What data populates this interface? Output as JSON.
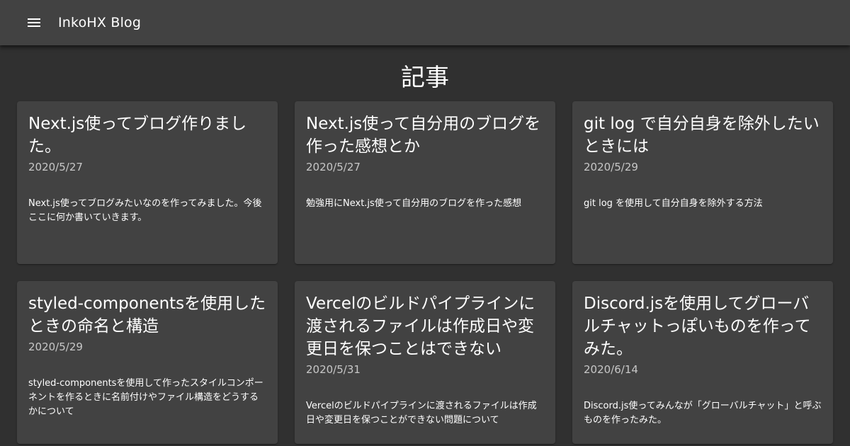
{
  "app": {
    "title": "InkoHX Blog",
    "menu_icon": "menu-icon"
  },
  "page": {
    "heading": "記事"
  },
  "posts": [
    {
      "title": "Next.js使ってブログ作りました。",
      "date": "2020/5/27",
      "description": "Next.js使ってブログみたいなのを作ってみました。今後ここに何か書いていきます。"
    },
    {
      "title": "Next.js使って自分用のブログを作った感想とか",
      "date": "2020/5/27",
      "description": "勉強用にNext.js使って自分用のブログを作った感想"
    },
    {
      "title": "git log で自分自身を除外したいときには",
      "date": "2020/5/29",
      "description": "git log を使用して自分自身を除外する方法"
    },
    {
      "title": "styled-componentsを使用したときの命名と構造",
      "date": "2020/5/29",
      "description": "styled-componentsを使用して作ったスタイルコンポーネントを作るときに名前付けやファイル構造をどうするかについて"
    },
    {
      "title": "Vercelのビルドパイプラインに渡されるファイルは作成日や変更日を保つことはできない",
      "date": "2020/5/31",
      "description": "Vercelのビルドパイプラインに渡されるファイルは作成日や変更日を保つことができない問題について"
    },
    {
      "title": "Discord.jsを使用してグローバルチャットっぽいものを作ってみた。",
      "date": "2020/6/14",
      "description": "Discord.js使ってみんなが「グローバルチャット」と呼ぶものを作ったみた。"
    }
  ],
  "colors": {
    "background": "#303030",
    "appbar": "#424242",
    "card": "#424242"
  }
}
